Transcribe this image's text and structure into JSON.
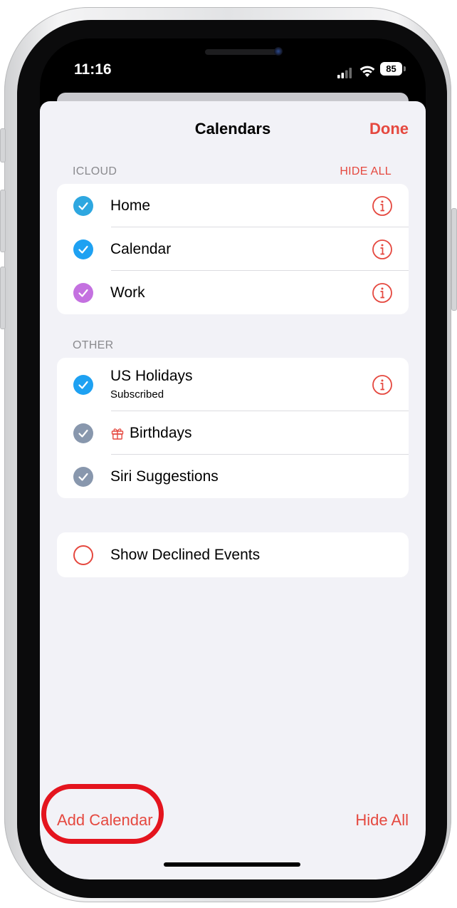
{
  "status_bar": {
    "time": "11:16",
    "battery": "85"
  },
  "sheet": {
    "title": "Calendars",
    "done_label": "Done"
  },
  "icloud": {
    "header": "ICLOUD",
    "hide_all": "HIDE ALL",
    "items": [
      {
        "label": "Home",
        "color": "#2ea7e0"
      },
      {
        "label": "Calendar",
        "color": "#1ea1f2"
      },
      {
        "label": "Work",
        "color": "#c471e0"
      }
    ]
  },
  "other": {
    "header": "OTHER",
    "items": [
      {
        "label": "US Holidays",
        "sublabel": "Subscribed",
        "color": "#1ea1f2"
      },
      {
        "label": "Birthdays",
        "color": "#8897ad"
      },
      {
        "label": "Siri Suggestions",
        "color": "#8897ad"
      }
    ]
  },
  "declined": {
    "label": "Show Declined Events"
  },
  "toolbar": {
    "add_calendar": "Add Calendar",
    "hide_all": "Hide All"
  },
  "colors": {
    "accent": "#e5483f",
    "highlight": "#e4141e"
  }
}
